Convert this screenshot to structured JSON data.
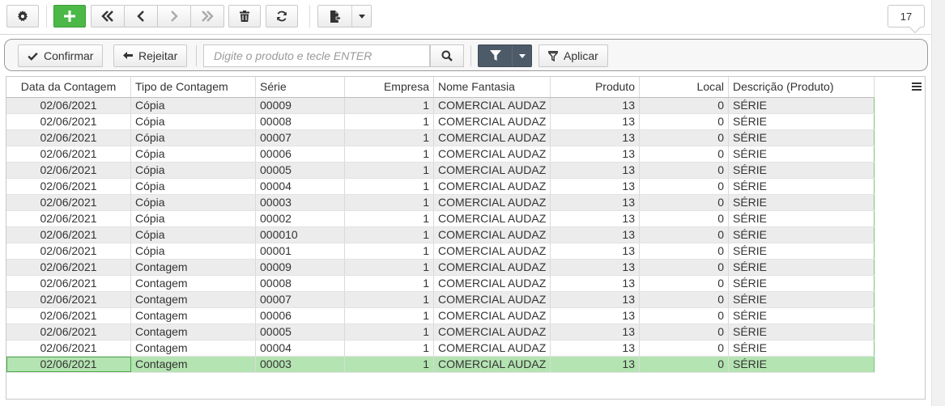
{
  "toolbar": {
    "buttons": [
      {
        "name": "settings-button",
        "icon": "gear-icon"
      },
      {
        "name": "add-button",
        "icon": "plus-icon"
      },
      {
        "name": "first-record-button",
        "icon": "double-chevron-left-icon"
      },
      {
        "name": "previous-record-button",
        "icon": "chevron-left-icon"
      },
      {
        "name": "next-record-button",
        "icon": "chevron-right-icon"
      },
      {
        "name": "last-record-button",
        "icon": "double-chevron-right-icon"
      },
      {
        "name": "delete-button",
        "icon": "trash-icon"
      },
      {
        "name": "refresh-button",
        "icon": "refresh-icon"
      },
      {
        "name": "export-button",
        "icon": "file-export-icon"
      }
    ],
    "record_count": "17"
  },
  "action_bar": {
    "confirm_label": "Confirmar",
    "reject_label": "Rejeitar",
    "search_placeholder": "Digite o produto e tecle ENTER",
    "apply_label": "Aplicar"
  },
  "colors": {
    "add_button": "#4cb848",
    "filter_button": "#4d5a68",
    "row_alt": "#ececec",
    "row_selected": "#b4e4b1"
  },
  "grid": {
    "columns": [
      "Data da Contagem",
      "Tipo de Contagem",
      "Série",
      "Empresa",
      "Nome Fantasia",
      "Produto",
      "Local",
      "Descrição (Produto)"
    ],
    "rows": [
      [
        "02/06/2021",
        "Cópia",
        "00009",
        "1",
        "COMERCIAL AUDAZ",
        "13",
        "0",
        "SÉRIE"
      ],
      [
        "02/06/2021",
        "Cópia",
        "00008",
        "1",
        "COMERCIAL AUDAZ",
        "13",
        "0",
        "SÉRIE"
      ],
      [
        "02/06/2021",
        "Cópia",
        "00007",
        "1",
        "COMERCIAL AUDAZ",
        "13",
        "0",
        "SÉRIE"
      ],
      [
        "02/06/2021",
        "Cópia",
        "00006",
        "1",
        "COMERCIAL AUDAZ",
        "13",
        "0",
        "SÉRIE"
      ],
      [
        "02/06/2021",
        "Cópia",
        "00005",
        "1",
        "COMERCIAL AUDAZ",
        "13",
        "0",
        "SÉRIE"
      ],
      [
        "02/06/2021",
        "Cópia",
        "00004",
        "1",
        "COMERCIAL AUDAZ",
        "13",
        "0",
        "SÉRIE"
      ],
      [
        "02/06/2021",
        "Cópia",
        "00003",
        "1",
        "COMERCIAL AUDAZ",
        "13",
        "0",
        "SÉRIE"
      ],
      [
        "02/06/2021",
        "Cópia",
        "00002",
        "1",
        "COMERCIAL AUDAZ",
        "13",
        "0",
        "SÉRIE"
      ],
      [
        "02/06/2021",
        "Cópia",
        "000010",
        "1",
        "COMERCIAL AUDAZ",
        "13",
        "0",
        "SÉRIE"
      ],
      [
        "02/06/2021",
        "Cópia",
        "00001",
        "1",
        "COMERCIAL AUDAZ",
        "13",
        "0",
        "SÉRIE"
      ],
      [
        "02/06/2021",
        "Contagem",
        "00009",
        "1",
        "COMERCIAL AUDAZ",
        "13",
        "0",
        "SÉRIE"
      ],
      [
        "02/06/2021",
        "Contagem",
        "00008",
        "1",
        "COMERCIAL AUDAZ",
        "13",
        "0",
        "SÉRIE"
      ],
      [
        "02/06/2021",
        "Contagem",
        "00007",
        "1",
        "COMERCIAL AUDAZ",
        "13",
        "0",
        "SÉRIE"
      ],
      [
        "02/06/2021",
        "Contagem",
        "00006",
        "1",
        "COMERCIAL AUDAZ",
        "13",
        "0",
        "SÉRIE"
      ],
      [
        "02/06/2021",
        "Contagem",
        "00005",
        "1",
        "COMERCIAL AUDAZ",
        "13",
        "0",
        "SÉRIE"
      ],
      [
        "02/06/2021",
        "Contagem",
        "00004",
        "1",
        "COMERCIAL AUDAZ",
        "13",
        "0",
        "SÉRIE"
      ],
      [
        "02/06/2021",
        "Contagem",
        "00003",
        "1",
        "COMERCIAL AUDAZ",
        "13",
        "0",
        "SÉRIE"
      ]
    ],
    "selected_row": 16
  }
}
